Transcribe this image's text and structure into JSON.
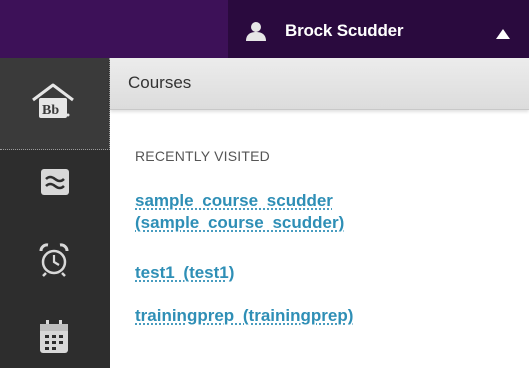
{
  "topbar": {
    "user_name": "Brock Scudder",
    "user_icon": "user-icon",
    "menu_caret": "caret-up-icon",
    "colors": {
      "bar": "#3d1158",
      "user_area": "#2a0a3e"
    }
  },
  "sidebar": {
    "items": [
      {
        "icon": "home-blackboard-icon",
        "active": true
      },
      {
        "icon": "stream-icon"
      },
      {
        "icon": "alarm-clock-icon"
      },
      {
        "icon": "calendar-icon"
      }
    ]
  },
  "main": {
    "title": "Courses",
    "section_label": "RECENTLY VISITED",
    "courses": [
      {
        "line1": "sample course scudder",
        "line2": "(sample course scudder)"
      },
      {
        "label": "test1 (test1)"
      },
      {
        "label": "trainingprep (trainingprep)"
      }
    ],
    "link_color": "#2f8fb6"
  }
}
